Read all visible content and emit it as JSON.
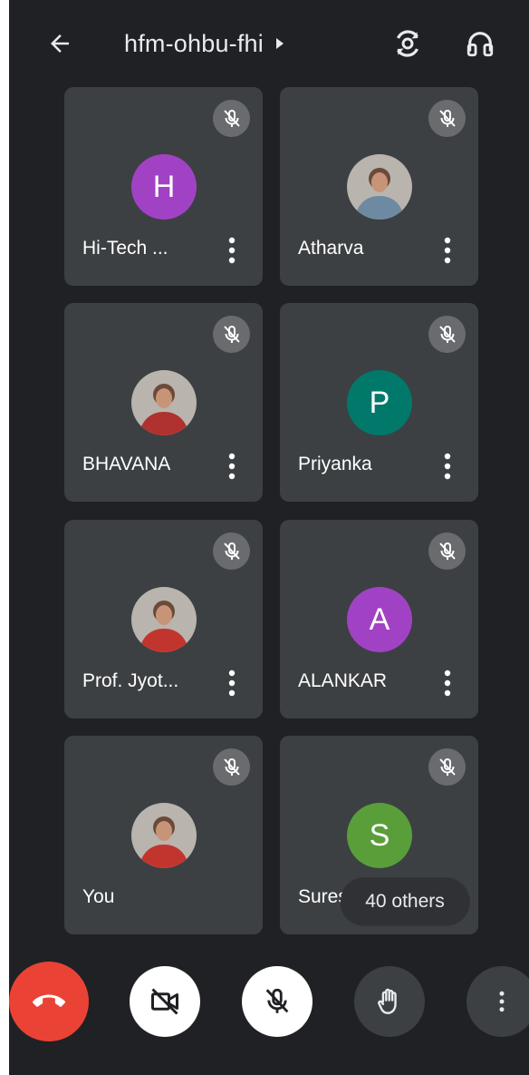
{
  "header": {
    "meeting_code": "hfm-ohbu-fhi",
    "back_icon": "arrow-back-icon",
    "title_chevron_icon": "caret-right-icon",
    "flip_icon": "flip-camera-icon",
    "audio_icon": "headphones-icon"
  },
  "participants": [
    {
      "name": "Hi-Tech ...",
      "avatar_type": "letter",
      "initial": "H",
      "avatar_color": "#a142c4",
      "muted": true
    },
    {
      "name": "Atharva",
      "avatar_type": "photo",
      "initial": "",
      "avatar_color": "#6e8aa3",
      "muted": true
    },
    {
      "name": "BHAVANA",
      "avatar_type": "photo",
      "initial": "",
      "avatar_color": "#b0322e",
      "muted": true
    },
    {
      "name": "Priyanka",
      "avatar_type": "letter",
      "initial": "P",
      "avatar_color": "#00796b",
      "muted": true
    },
    {
      "name": "Prof. Jyot...",
      "avatar_type": "photo",
      "initial": "",
      "avatar_color": "#c2352e",
      "muted": true
    },
    {
      "name": "ALANKAR",
      "avatar_type": "letter",
      "initial": "A",
      "avatar_color": "#a142c4",
      "muted": true
    },
    {
      "name": "You",
      "avatar_type": "photo",
      "initial": "",
      "avatar_color": "#c2352e",
      "muted": true
    },
    {
      "name": "Suresh",
      "avatar_type": "letter",
      "initial": "S",
      "avatar_color": "#5a9e3a",
      "muted": true
    }
  ],
  "others_label": "40 others",
  "controls": {
    "end_call_icon": "end-call-icon",
    "camera_off_icon": "camera-off-icon",
    "mic_off_icon": "mic-off-icon",
    "raise_hand_icon": "raise-hand-icon",
    "more_options_icon": "more-vert-icon"
  },
  "colors": {
    "background": "#202124",
    "tile": "#3c4043",
    "end_call": "#ea4335"
  }
}
